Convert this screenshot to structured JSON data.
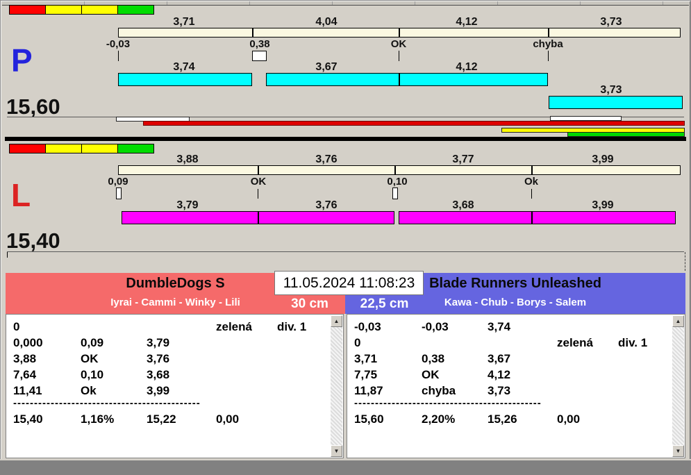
{
  "datetime": "11.05.2024 11:08:23",
  "colors": {
    "window_bg": "#D4D0C8",
    "legend": [
      "#FF0000",
      "#FFFF00",
      "#FFFF00",
      "#00DC00"
    ],
    "split_track": "#FBF8E1",
    "p_run_bar": "#00FFFF",
    "l_run_bar": "#FF00FF",
    "p_letter": "#2323DC",
    "l_letter": "#DC2323",
    "progress_white": "#FFFFFF",
    "progress_red": "#DE0000",
    "progress_yellow": "#FFFF00",
    "progress_green": "#00D800",
    "team_left_bg": "#F56A6A",
    "team_right_bg": "#6565E0"
  },
  "panels": {
    "p": {
      "letter": "P",
      "total": "15,60",
      "splits": [
        "3,71",
        "4,04",
        "4,12",
        "3,73"
      ],
      "markers": [
        "-0,03",
        "0,38",
        "OK",
        "chyba"
      ],
      "runs": [
        "3,74",
        "3,67",
        "4,12",
        "3,73"
      ]
    },
    "l": {
      "letter": "L",
      "total": "15,40",
      "splits": [
        "3,88",
        "3,76",
        "3,77",
        "3,99"
      ],
      "markers": [
        "0,09",
        "OK",
        "0,10",
        "Ok"
      ],
      "runs": [
        "3,79",
        "3,76",
        "3,68",
        "3,99"
      ]
    }
  },
  "teams": {
    "left": {
      "name": "DumbleDogs S",
      "dogs": "Iyrai - Cammi - Winky - Lili",
      "jump_height": "30 cm",
      "rows": [
        [
          "0",
          "",
          "",
          "zelená",
          "div. 1"
        ],
        [
          "0,000",
          "0,09",
          "3,79",
          "",
          ""
        ],
        [
          "3,88",
          "OK",
          "3,76",
          "",
          ""
        ],
        [
          "7,64",
          "0,10",
          "3,68",
          "",
          ""
        ],
        [
          "11,41",
          "Ok",
          "3,99",
          "",
          ""
        ]
      ],
      "separator": "---------------------------------------------",
      "summary": [
        "15,40",
        "1,16%",
        "15,22",
        "0,00"
      ]
    },
    "right": {
      "name": "Blade Runners Unleashed",
      "dogs": "Kawa - Chub - Borys - Salem",
      "jump_height": "22,5 cm",
      "rows": [
        [
          "-0,03",
          "-0,03",
          "3,74",
          "",
          ""
        ],
        [
          "0",
          "",
          "",
          "zelená",
          "div. 1"
        ],
        [
          "3,71",
          "0,38",
          "3,67",
          "",
          ""
        ],
        [
          "7,75",
          "OK",
          "4,12",
          "",
          ""
        ],
        [
          "11,87",
          "chyba",
          "3,73",
          "",
          ""
        ]
      ],
      "separator": "---------------------------------------------",
      "summary": [
        "15,60",
        "2,20%",
        "15,26",
        "0,00"
      ]
    }
  },
  "scrollbar": {
    "up": "▲",
    "down": "▼"
  }
}
